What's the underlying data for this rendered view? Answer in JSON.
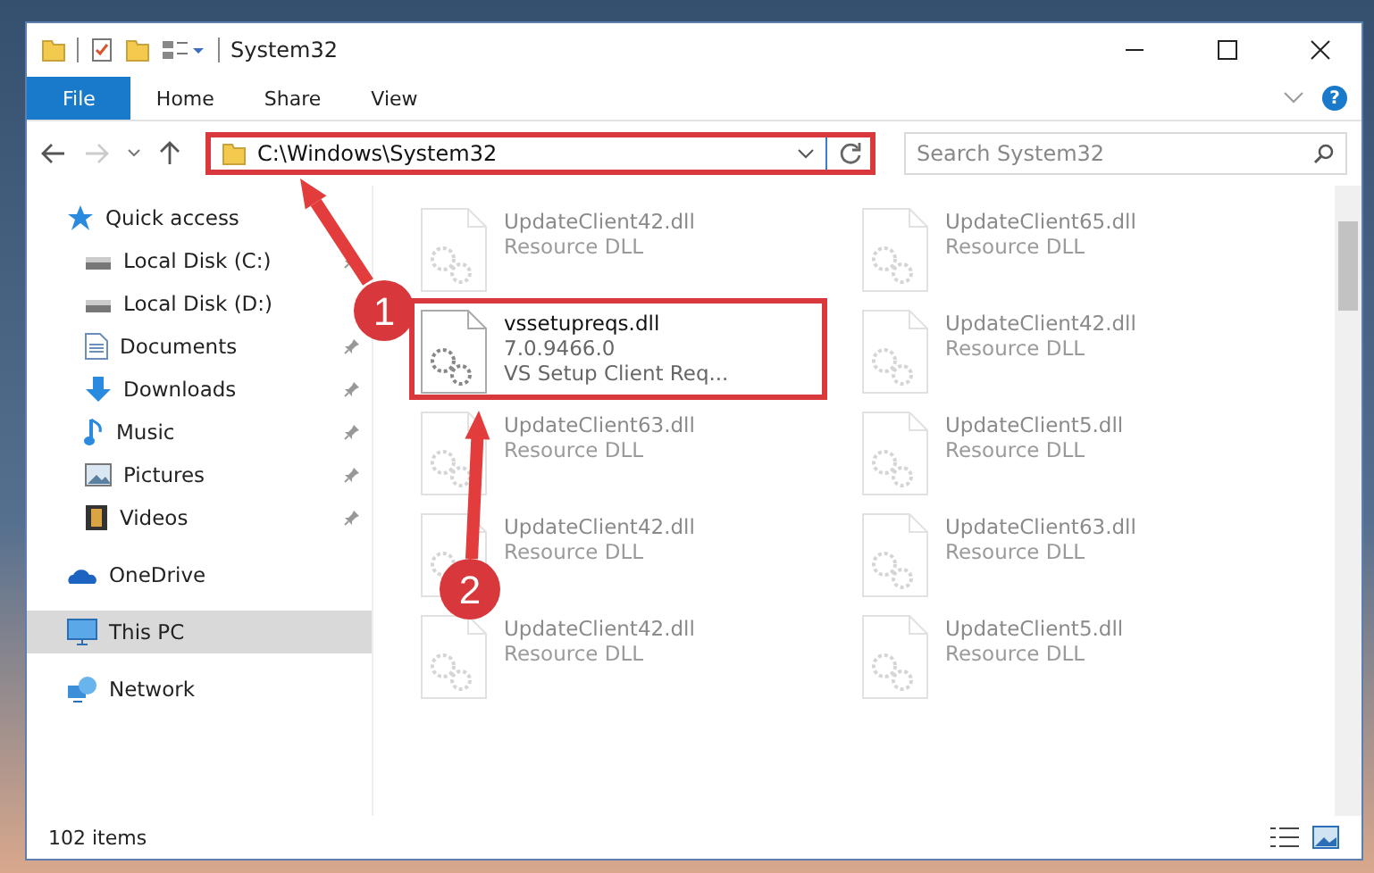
{
  "window": {
    "title": "System32"
  },
  "ribbon": {
    "tabs": [
      {
        "label": "File",
        "selected": true
      },
      {
        "label": "Home",
        "selected": false
      },
      {
        "label": "Share",
        "selected": false
      },
      {
        "label": "View",
        "selected": false
      }
    ],
    "help": "?"
  },
  "address": {
    "path": "C:\\Windows\\System32",
    "highlighted": true
  },
  "search": {
    "placeholder": "Search System32"
  },
  "sidebar": {
    "items": [
      {
        "label": "Quick access",
        "selected": false,
        "children": [
          {
            "label": "Local Disk (C:)",
            "pinned": true
          },
          {
            "label": "Local Disk (D:)",
            "pinned": false
          },
          {
            "label": "Documents",
            "pinned": true
          },
          {
            "label": "Downloads",
            "pinned": true
          },
          {
            "label": "Music",
            "pinned": true
          },
          {
            "label": "Pictures",
            "pinned": true
          },
          {
            "label": "Videos",
            "pinned": true
          }
        ]
      },
      {
        "label": "OneDrive",
        "selected": false
      },
      {
        "label": "This PC",
        "selected": true
      },
      {
        "label": "Network",
        "selected": false
      }
    ]
  },
  "files": [
    {
      "name": "UpdateClient42.dll",
      "type": "Resource DLL",
      "dimmed": true,
      "highlighted": false
    },
    {
      "name": "UpdateClient65.dll",
      "type": "Resource DLL",
      "dimmed": true,
      "highlighted": false
    },
    {
      "name": "vssetupreqs.dll",
      "version": "7.0.9466.0",
      "type": "VS Setup Client Req...",
      "dimmed": false,
      "highlighted": true
    },
    {
      "name": "UpdateClient42.dll",
      "type": "Resource DLL",
      "dimmed": true,
      "highlighted": false
    },
    {
      "name": "UpdateClient63.dll",
      "type": "Resource DLL",
      "dimmed": true,
      "highlighted": false
    },
    {
      "name": "UpdateClient5.dll",
      "type": "Resource DLL",
      "dimmed": true,
      "highlighted": false
    },
    {
      "name": "UpdateClient42.dll",
      "type": "Resource DLL",
      "dimmed": true,
      "highlighted": false
    },
    {
      "name": "UpdateClient63.dll",
      "type": "Resource DLL",
      "dimmed": true,
      "highlighted": false
    },
    {
      "name": "UpdateClient42.dll",
      "type": "Resource DLL",
      "dimmed": true,
      "highlighted": false
    },
    {
      "name": "UpdateClient5.dll",
      "type": "Resource DLL",
      "dimmed": true,
      "highlighted": false
    }
  ],
  "callouts": [
    "1",
    "2"
  ],
  "status_bar": {
    "count": "102 items"
  }
}
